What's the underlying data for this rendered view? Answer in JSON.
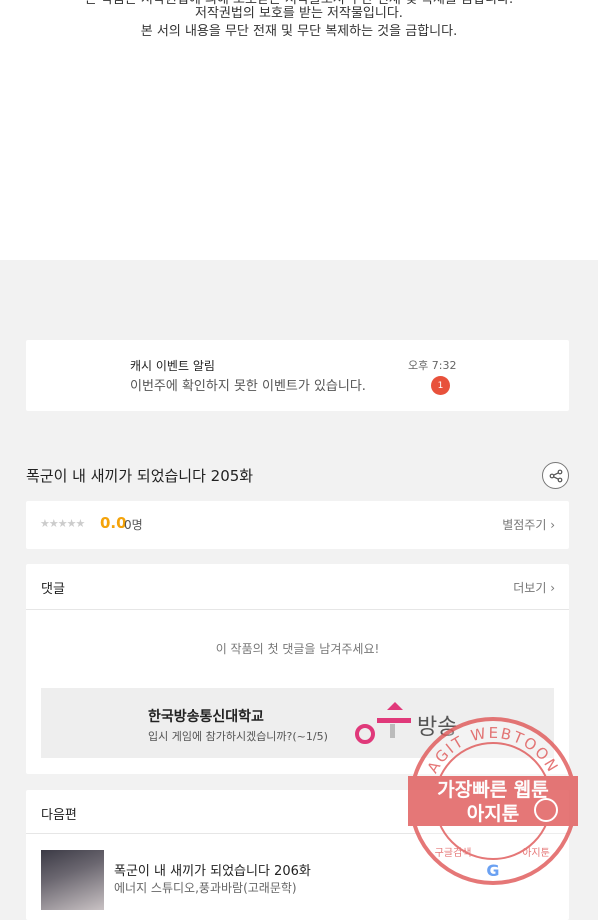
{
  "notice": {
    "line0": "본 작품은 저작권법에 의해 보호받는 저작물로서 무단 전재 및 복제를 금합니다.",
    "line1": "저작권법의 보호를 받는 저작물입니다.",
    "line2": "본 서의 내용을 무단 전재 및 무단 복제하는 것을 금합니다."
  },
  "alert": {
    "title": "캐시 이벤트 알림",
    "message": "이번주에 확인하지 못한 이벤트가 있습니다.",
    "time": "오후 7:32",
    "badge": "1"
  },
  "episode": {
    "title": "폭군이 내 새끼가 되었습니다 205화"
  },
  "rating": {
    "stars": "★★★★★",
    "score": "0.0",
    "count": "0명",
    "rate_label": "별점주기 ›"
  },
  "comments": {
    "title": "댓글",
    "more": "더보기 ›",
    "empty": "이 작품의 첫 댓글을 남겨주세요!"
  },
  "ad": {
    "headline": "한국방송통신대학교",
    "sub": "입시 게임에 참가하시겠습니까?(~1/5)",
    "logo_text": "방송대"
  },
  "next": {
    "title": "다음편",
    "item_title": "폭군이 내 새끼가 되었습니다 206화",
    "item_author": "에너지 스튜디오,풍과바람(고래문학)"
  },
  "watermark": {
    "ring_text": "AGIT WEBTOON",
    "line1": "가장빠른 웹툰",
    "line2": "아지툰",
    "bottom_left": "구글검색",
    "bottom_right": "아지툰",
    "color": "#e05a5a"
  }
}
